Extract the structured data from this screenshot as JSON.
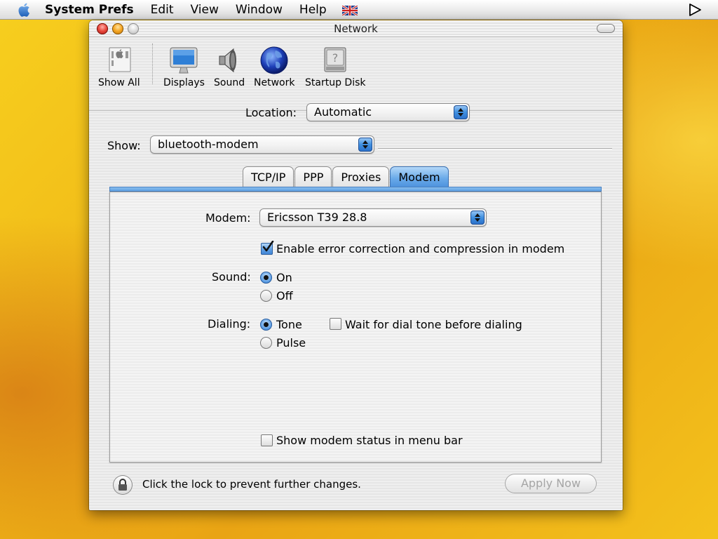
{
  "menubar": {
    "app": "System Prefs",
    "items": [
      "Edit",
      "View",
      "Window",
      "Help"
    ]
  },
  "window": {
    "title": "Network"
  },
  "toolbar": {
    "show_all": "Show All",
    "displays": "Displays",
    "sound": "Sound",
    "network": "Network",
    "startup_disk": "Startup Disk"
  },
  "location": {
    "label": "Location:",
    "value": "Automatic"
  },
  "show": {
    "label": "Show:",
    "value": "bluetooth-modem"
  },
  "tabs": [
    {
      "label": "TCP/IP",
      "active": false
    },
    {
      "label": "PPP",
      "active": false
    },
    {
      "label": "Proxies",
      "active": false
    },
    {
      "label": "Modem",
      "active": true
    }
  ],
  "modem_panel": {
    "modem_label": "Modem:",
    "modem_value": "Ericsson T39 28.8",
    "error_correction": {
      "label": "Enable error correction and compression in modem",
      "checked": true
    },
    "sound_label": "Sound:",
    "sound_options": [
      {
        "label": "On",
        "selected": true
      },
      {
        "label": "Off",
        "selected": false
      }
    ],
    "dialing_label": "Dialing:",
    "dialing_options": [
      {
        "label": "Tone",
        "selected": true
      },
      {
        "label": "Pulse",
        "selected": false
      }
    ],
    "wait_dial_tone": {
      "label": "Wait for dial tone before dialing",
      "checked": false
    },
    "show_status": {
      "label": "Show modem status in menu bar",
      "checked": false
    }
  },
  "footer": {
    "lock_text": "Click the lock to prevent further changes.",
    "apply_label": "Apply Now"
  },
  "colors": {
    "accent": "#4a8fdc",
    "desktop": "#f0b818"
  }
}
